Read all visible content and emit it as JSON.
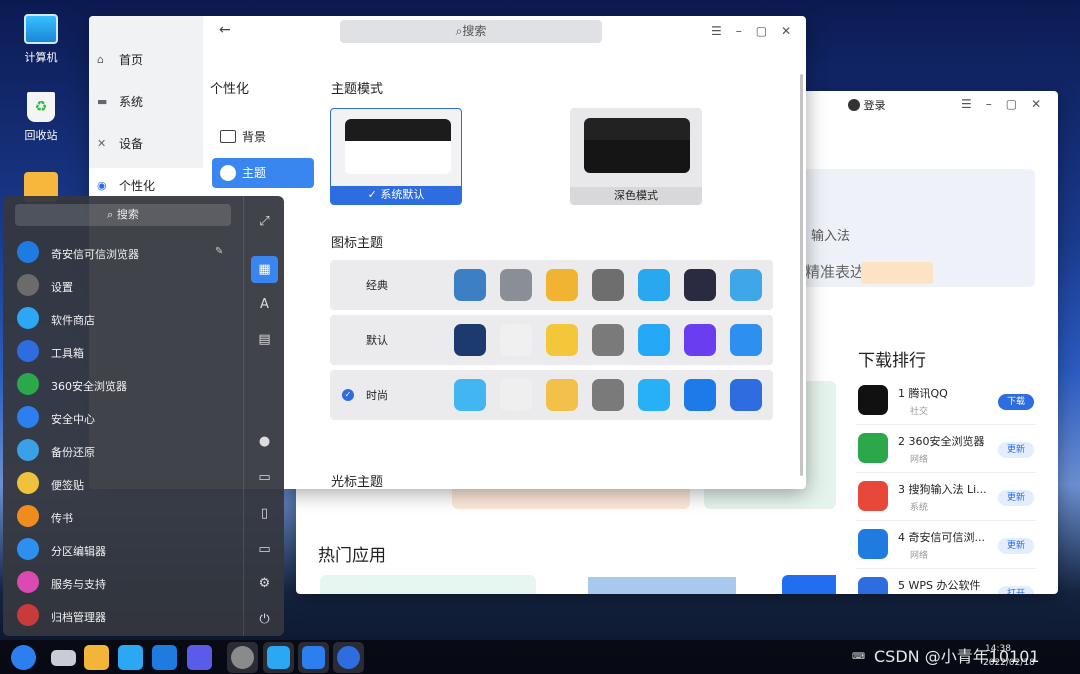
{
  "desktop": {
    "icons": [
      {
        "label": "计算机"
      },
      {
        "label": "回收站"
      }
    ]
  },
  "store": {
    "login_label": "登录",
    "banner_text1": "输入法",
    "banner_text2": "精准表达",
    "rank_title": "下载排行",
    "rank": [
      {
        "num": "1",
        "name": "腾讯QQ",
        "cat": "社交",
        "btn": "下载",
        "color": "#111111"
      },
      {
        "num": "2",
        "name": "360安全浏览器",
        "cat": "网络",
        "btn": "更新",
        "color": "#2aa84a"
      },
      {
        "num": "3",
        "name": "搜狗输入法 Li...",
        "cat": "系统",
        "btn": "更新",
        "color": "#e8483a"
      },
      {
        "num": "4",
        "name": "奇安信可信浏...",
        "cat": "网络",
        "btn": "更新",
        "color": "#1f7be0"
      },
      {
        "num": "5",
        "name": "WPS 办公软件",
        "cat": "",
        "btn": "打开",
        "color": "#2d6de0"
      }
    ],
    "hot_title": "热门应用"
  },
  "settings": {
    "search_placeholder": "搜索",
    "nav_main": [
      {
        "label": "首页",
        "icon": "⌂"
      },
      {
        "label": "系统",
        "icon": "▬"
      },
      {
        "label": "设备",
        "icon": "✕"
      },
      {
        "label": "个性化",
        "icon": "◉"
      }
    ],
    "nav_section": "个性化",
    "nav_sub": [
      {
        "label": "背景"
      },
      {
        "label": "主题"
      }
    ],
    "theme_mode_title": "主题模式",
    "theme_modes": [
      {
        "label": "系统默认"
      },
      {
        "label": "深色模式"
      }
    ],
    "icon_theme_title": "图标主题",
    "icon_themes": [
      {
        "label": "经典"
      },
      {
        "label": "默认"
      },
      {
        "label": "时尚"
      }
    ],
    "cursor_theme_title": "光标主题"
  },
  "start_menu": {
    "search_placeholder": "搜索",
    "apps": [
      {
        "label": "奇安信可信浏览器",
        "color": "#1f7be0"
      },
      {
        "label": "设置",
        "color": "#6b6b6b"
      },
      {
        "label": "软件商店",
        "color": "#2ba7f3"
      },
      {
        "label": "工具箱",
        "color": "#2d6de0"
      },
      {
        "label": "360安全浏览器",
        "color": "#2aa84a"
      },
      {
        "label": "安全中心",
        "color": "#2d7ff0"
      },
      {
        "label": "备份还原",
        "color": "#3aa0e8"
      },
      {
        "label": "便签贴",
        "color": "#f0c23c"
      },
      {
        "label": "传书",
        "color": "#f08c1e"
      },
      {
        "label": "分区编辑器",
        "color": "#2d8ff0"
      },
      {
        "label": "服务与支持",
        "color": "#d94bb0"
      },
      {
        "label": "归档管理器",
        "color": "#c83b3b"
      }
    ]
  },
  "taskbar": {
    "time": "14:38",
    "date": "2022/02/18"
  },
  "watermark": "CSDN @小青年10101"
}
